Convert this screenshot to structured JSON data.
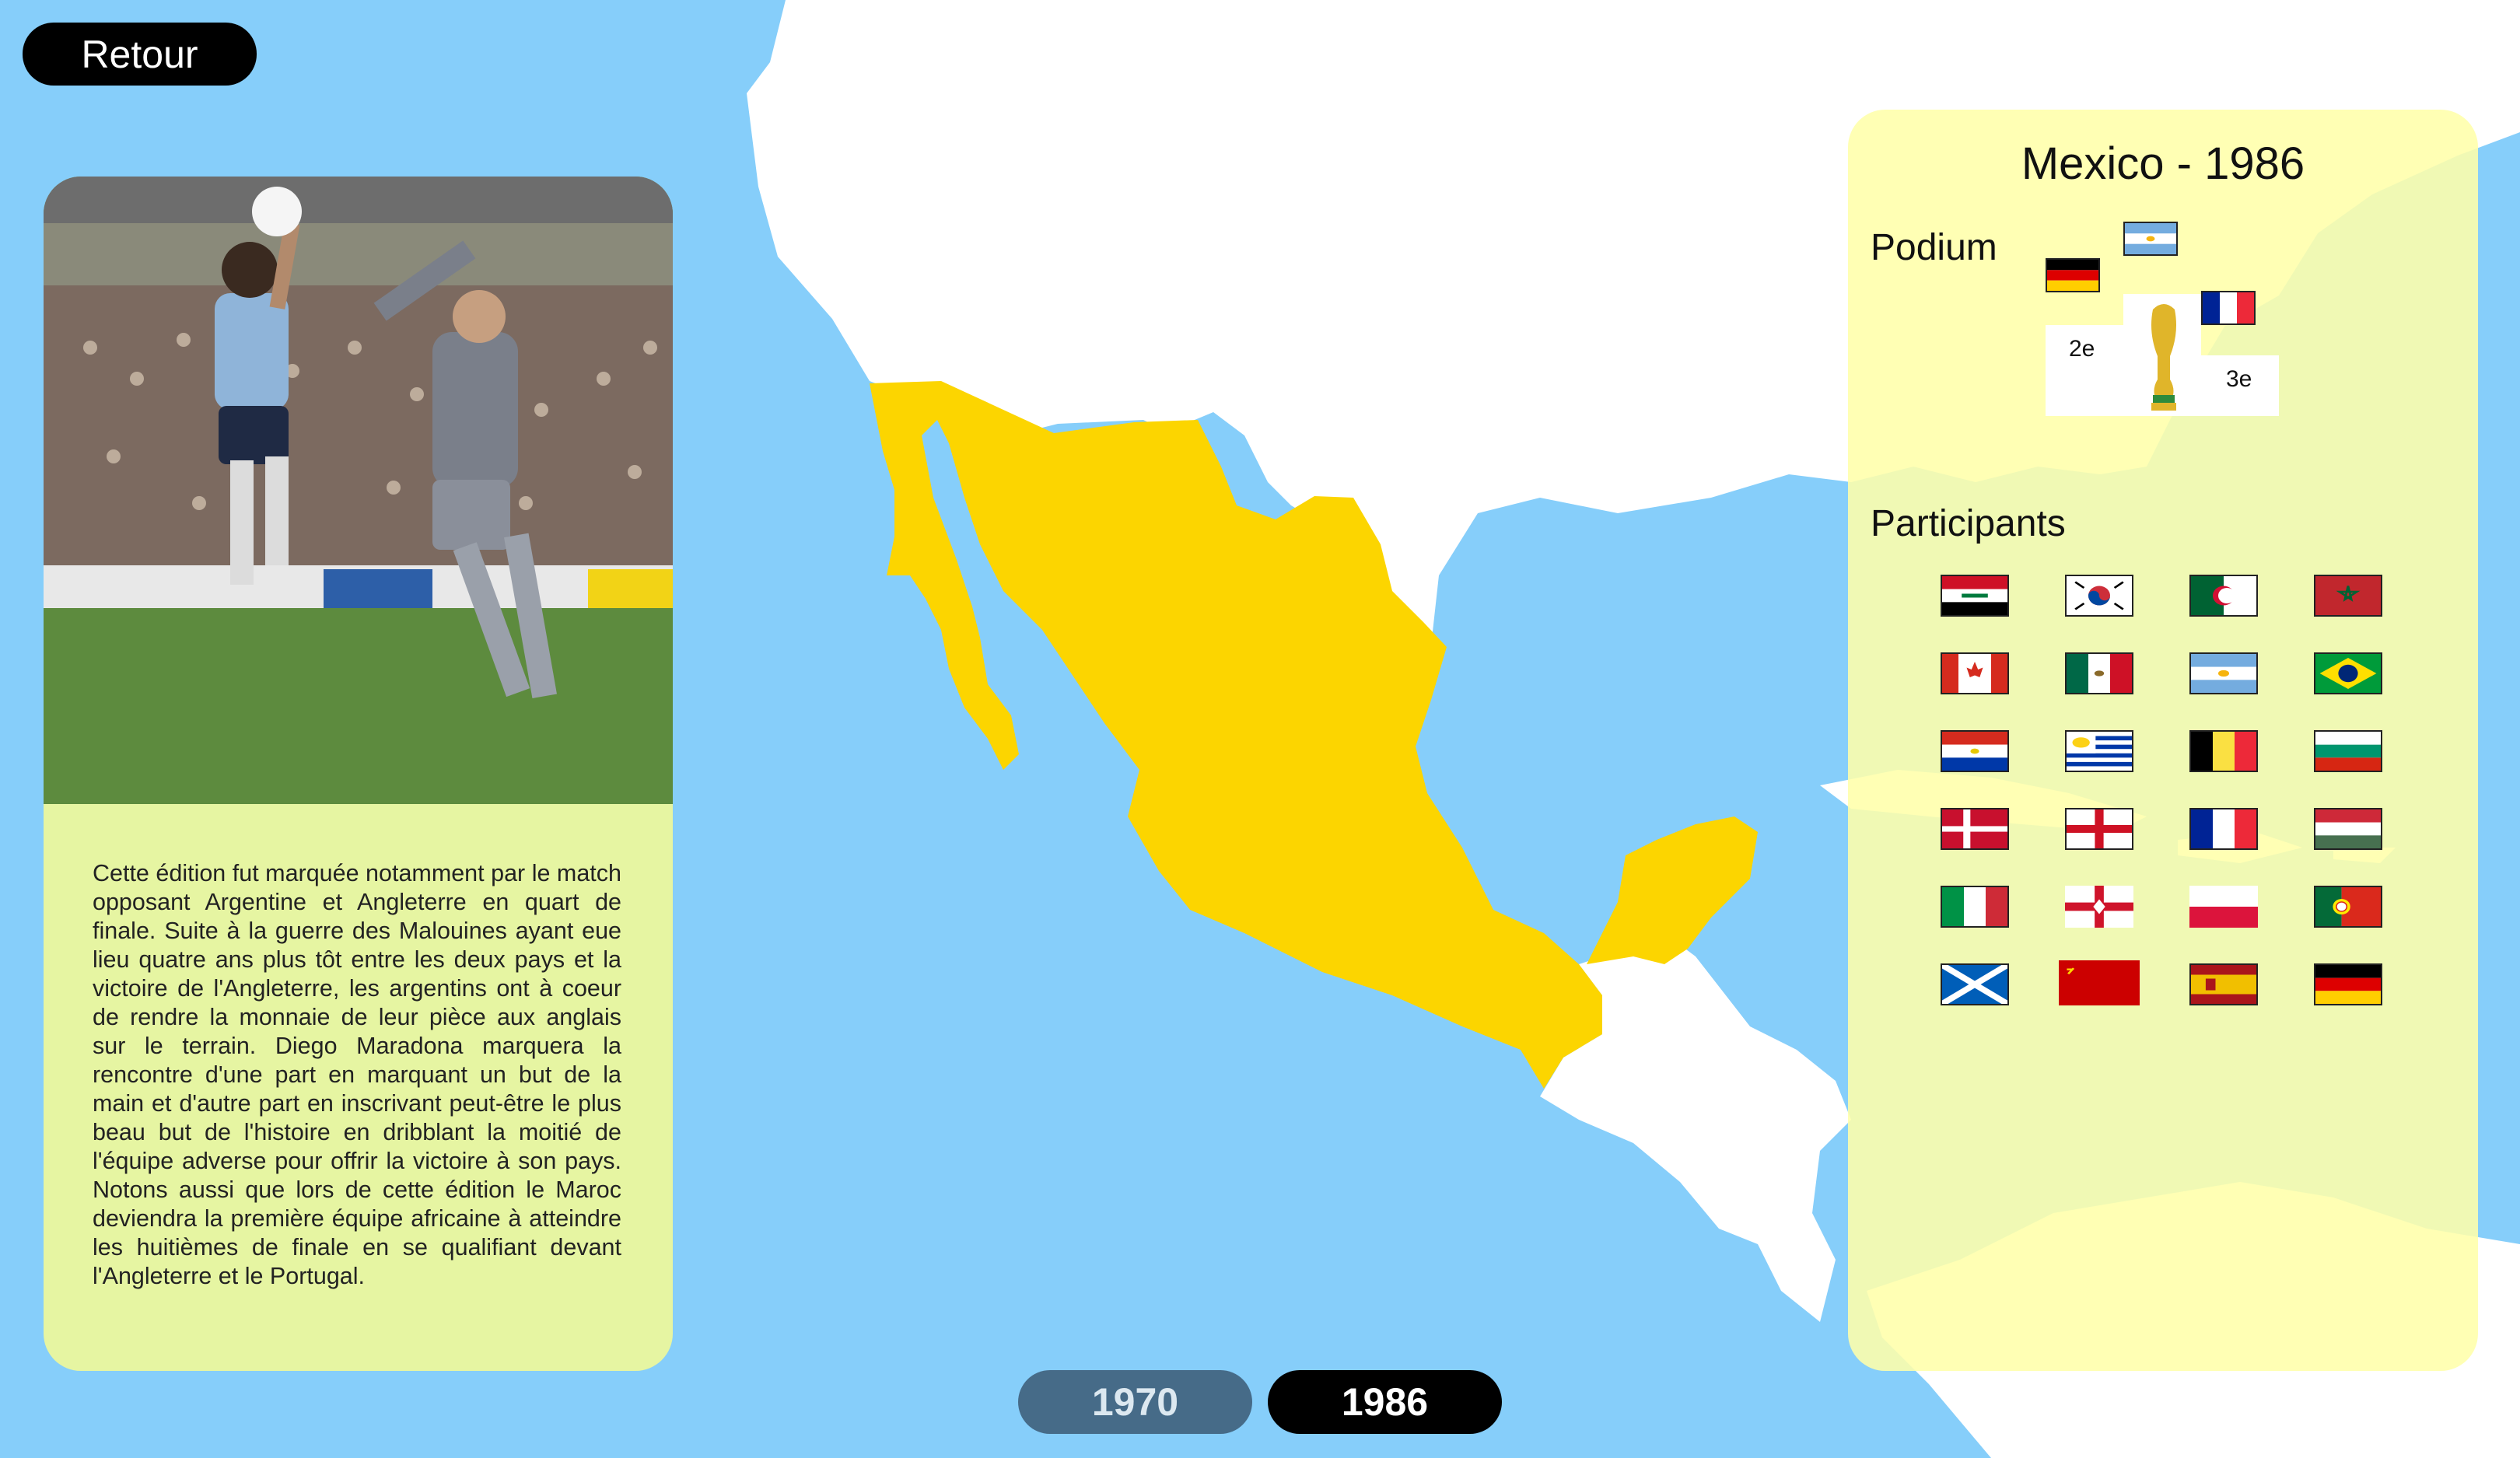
{
  "nav": {
    "back_label": "Retour"
  },
  "colors": {
    "ocean": "#86cefa",
    "land": "#ffffff",
    "host_country": "#fcd500",
    "info_card": "#e6f5a2",
    "panel": "#ffffaa",
    "active_year": "#000000",
    "inactive_year": "#466b88"
  },
  "description": "Cette édition fut marquée notamment par le match opposant Argentine et Angleterre en quart de finale. Suite à la guerre des Malouines ayant eue lieu quatre ans plus tôt entre les deux pays et la victoire de l'Angleterre, les argentins ont à coeur de rendre la monnaie de leur pièce aux anglais sur le terrain. Diego Maradona marquera la rencontre d'une part en marquant un but de la main et d'autre part en inscrivant peut-être le plus beau but de l'histoire en dribblant la moitié de l'équipe adverse pour offrir la victoire à son pays. Notons aussi que lors de cette édition le Maroc deviendra la première équipe africaine à atteindre les huitièmes de finale en se qualifiant devant l'Angleterre et le Portugal.",
  "panel": {
    "title": "Mexico - 1986",
    "podium_heading": "Podium",
    "participants_heading": "Participants",
    "podium": {
      "first": "argentina-flag-icon",
      "second": "germany-flag-icon",
      "third": "france-flag-icon",
      "second_label": "2e",
      "third_label": "3e",
      "trophy": "world-cup-trophy-icon"
    },
    "participants": [
      "iraq",
      "south-korea",
      "algeria",
      "morocco",
      "canada",
      "mexico",
      "argentina",
      "brazil",
      "paraguay",
      "uruguay",
      "belgium",
      "bulgaria",
      "denmark",
      "england",
      "france",
      "hungary",
      "italy",
      "northern-ireland",
      "poland",
      "portugal",
      "scotland",
      "soviet-union",
      "spain",
      "west-germany"
    ]
  },
  "timeline": {
    "years": [
      "1970",
      "1986"
    ],
    "active": "1986"
  }
}
